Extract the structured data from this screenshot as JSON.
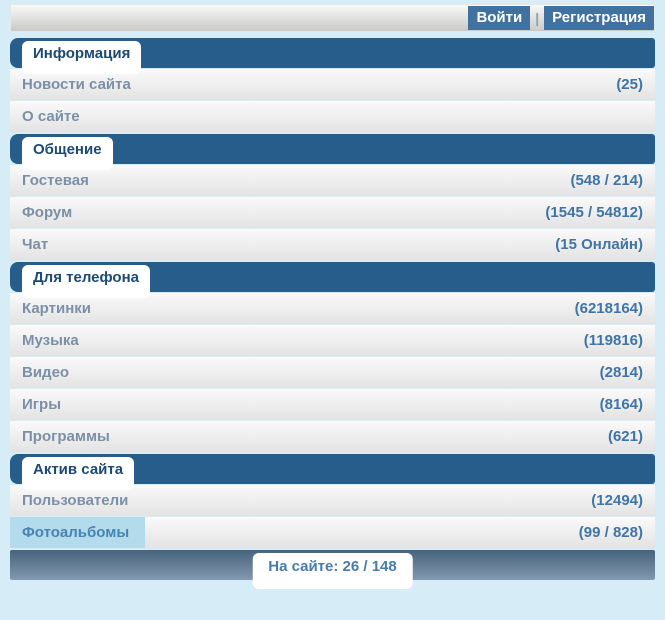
{
  "topbar": {
    "login_label": "Войти",
    "separator": "|",
    "register_label": "Регистрация"
  },
  "sections": [
    {
      "title": "Информация",
      "items": [
        {
          "label": "Новости сайта",
          "count": "(25)"
        },
        {
          "label": "О сайте",
          "count": ""
        }
      ]
    },
    {
      "title": "Общение",
      "items": [
        {
          "label": "Гостевая",
          "count": "(548 / 214)"
        },
        {
          "label": "Форум",
          "count": "(1545 / 54812)"
        },
        {
          "label": "Чат",
          "count": "(15 Онлайн)"
        }
      ]
    },
    {
      "title": "Для телефона",
      "items": [
        {
          "label": "Картинки",
          "count": "(6218164)"
        },
        {
          "label": "Музыка",
          "count": "(119816)"
        },
        {
          "label": "Видео",
          "count": "(2814)"
        },
        {
          "label": "Игры",
          "count": "(8164)"
        },
        {
          "label": "Программы",
          "count": "(621)"
        }
      ]
    },
    {
      "title": "Актив сайта",
      "items": [
        {
          "label": "Пользователи",
          "count": "(12494)"
        },
        {
          "label": "Фотоальбомы",
          "count": "(99 / 828)",
          "highlighted": true
        }
      ]
    }
  ],
  "footer": {
    "online_label": "На сайте: 26 / 148"
  },
  "colors": {
    "page_background": "#d6edf8",
    "section_bar": "#275d8b",
    "button_blue": "#41719f",
    "count_blue": "#3f74a6",
    "highlight_blue": "#b4dbeb",
    "footer_gradient_top": "#47637d",
    "footer_gradient_bottom": "#8299ae"
  }
}
